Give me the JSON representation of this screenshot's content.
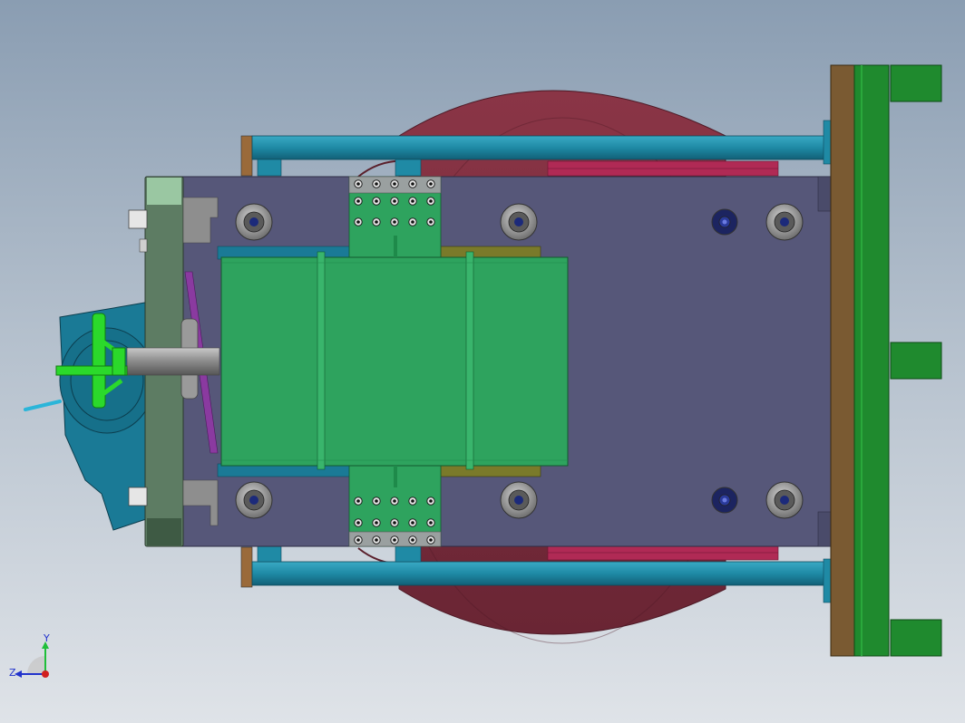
{
  "view": {
    "background_top": "#8a9db2",
    "background_bottom": "#dfe3e8"
  },
  "triad": {
    "y_label": "Y",
    "z_label": "Z",
    "y_color": "#1fbf3a",
    "z_color": "#2233cc",
    "x_color": "#d21f1f"
  },
  "colors": {
    "rotary_table": "#7a2f3e",
    "rotary_table_edge": "#5a1f2b",
    "frame_rail": "#1f8aa5",
    "base_plate": "#565779",
    "mount_plate_light": "#7fa987",
    "mount_plate_dark": "#5d7c63",
    "part_green": "#2ea35e",
    "end_plate_brown": "#7a5a32",
    "end_plate_green": "#1f8a2e",
    "handwheel": "#2bd92b",
    "gearbox": "#1a7a96",
    "bolt_gray": "#8e8e8e",
    "olive_block": "#7a7a2a",
    "magenta_strip": "#b02a55",
    "purple_link": "#8a3aa0"
  }
}
